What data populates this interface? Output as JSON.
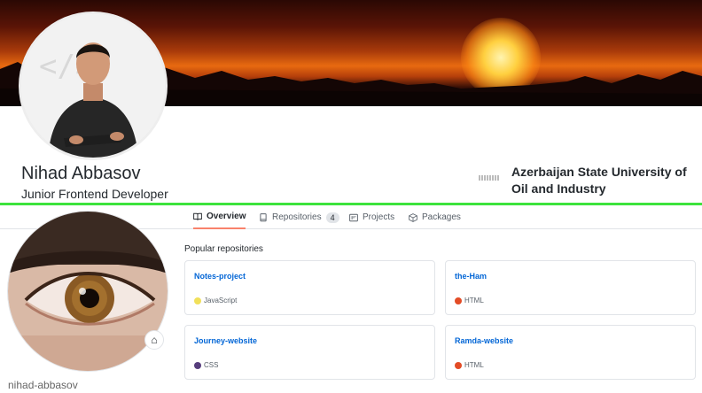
{
  "profile": {
    "name": "Nihad Abbasov",
    "title": "Junior Frontend Developer",
    "university": "Azerbaijan State University of Oil and Industry"
  },
  "tabs": [
    {
      "label": "Overview",
      "icon": "book-icon",
      "active": true
    },
    {
      "label": "Repositories",
      "icon": "repo-icon",
      "count": "4"
    },
    {
      "label": "Projects",
      "icon": "project-icon"
    },
    {
      "label": "Packages",
      "icon": "package-icon"
    }
  ],
  "sidebar": {
    "username": "nihad-abbasov",
    "status_icon": "house-icon"
  },
  "popular": {
    "title": "Popular repositories",
    "repos": [
      {
        "name": "Notes-project",
        "language": "JavaScript",
        "color": "#f1e05a"
      },
      {
        "name": "the-Ham",
        "language": "HTML",
        "color": "#e34c26"
      },
      {
        "name": "Journey-website",
        "language": "CSS",
        "color": "#563d7c"
      },
      {
        "name": "Ramda-website",
        "language": "HTML",
        "color": "#e34c26"
      }
    ]
  },
  "colors": {
    "accent_line": "#3ce33c",
    "tab_underline": "#f9826c",
    "link": "#0366d6"
  }
}
